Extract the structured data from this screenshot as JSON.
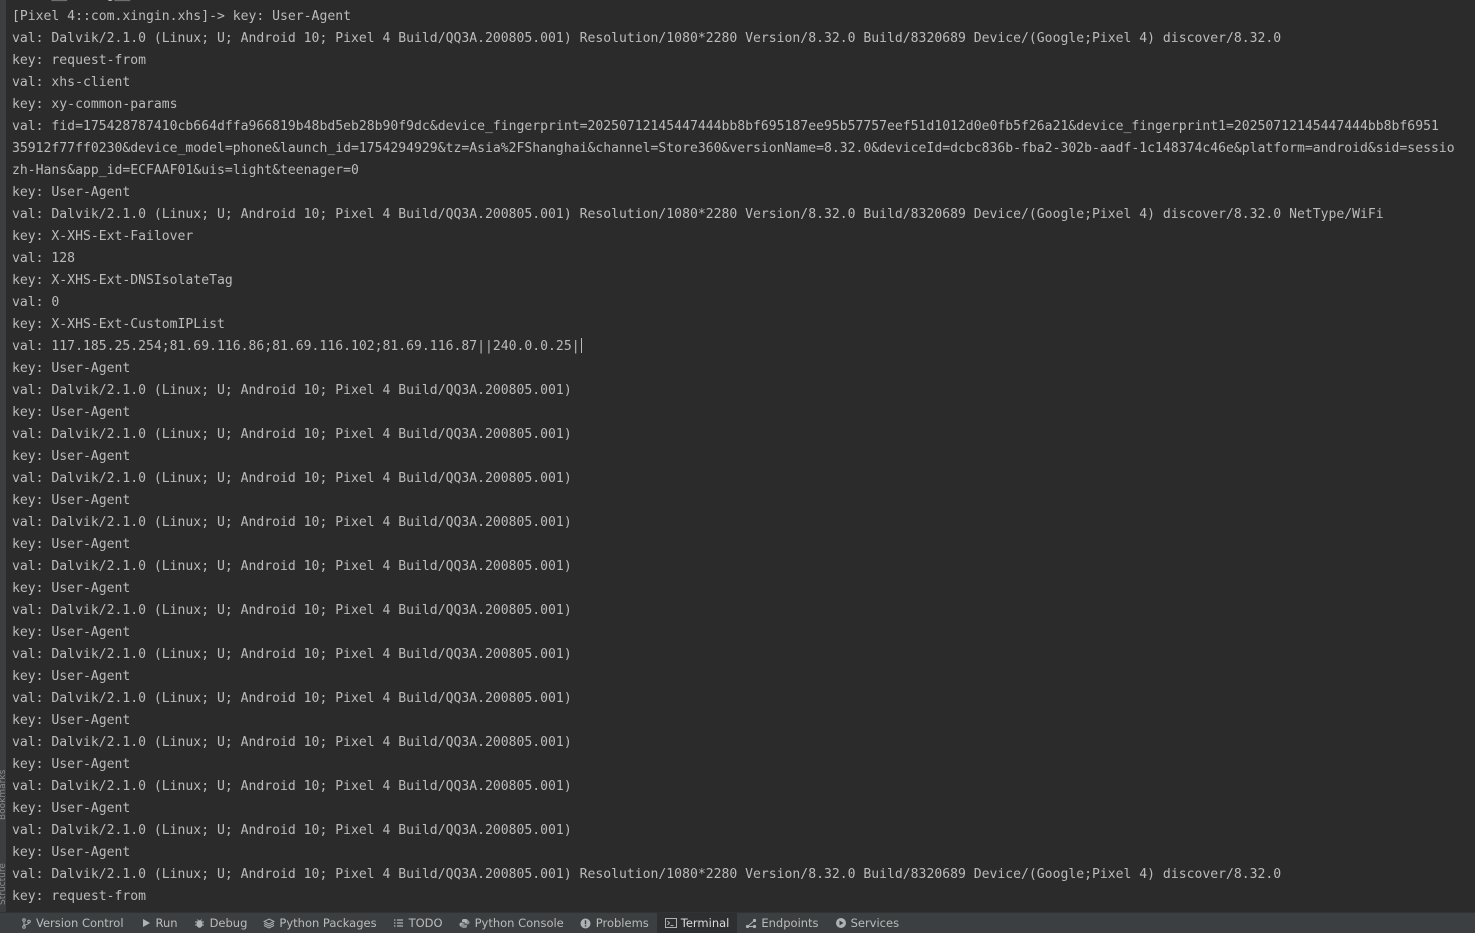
{
  "left_strip": {
    "bookmarks_label": "Bookmarks",
    "structure_label": "Structure"
  },
  "terminal": {
    "lines": [
      "val: __string__",
      "[Pixel 4::com.xingin.xhs]-> key: User-Agent",
      "val: Dalvik/2.1.0 (Linux; U; Android 10; Pixel 4 Build/QQ3A.200805.001) Resolution/1080*2280 Version/8.32.0 Build/8320689 Device/(Google;Pixel 4) discover/8.32.0",
      "key: request-from",
      "val: xhs-client",
      "key: xy-common-params",
      "val: fid=175428787410cb664dffa966819b48bd5eb28b90f9dc&device_fingerprint=20250712145447444bb8bf695187ee95b57757eef51d1012d0e0fb5f26a21&device_fingerprint1=20250712145447444bb8bf6951",
      "35912f77ff0230&device_model=phone&launch_id=1754294929&tz=Asia%2FShanghai&channel=Store360&versionName=8.32.0&deviceId=dcbc836b-fba2-302b-aadf-1c148374c46e&platform=android&sid=sessio",
      "zh-Hans&app_id=ECFAAF01&uis=light&teenager=0",
      "key: User-Agent",
      "val: Dalvik/2.1.0 (Linux; U; Android 10; Pixel 4 Build/QQ3A.200805.001) Resolution/1080*2280 Version/8.32.0 Build/8320689 Device/(Google;Pixel 4) discover/8.32.0 NetType/WiFi",
      "key: X-XHS-Ext-Failover",
      "val: 128",
      "key: X-XHS-Ext-DNSIsolateTag",
      "val: 0",
      "key: X-XHS-Ext-CustomIPList",
      "val: 117.185.25.254;81.69.116.86;81.69.116.102;81.69.116.87||240.0.0.25|",
      "key: User-Agent",
      "val: Dalvik/2.1.0 (Linux; U; Android 10; Pixel 4 Build/QQ3A.200805.001)",
      "key: User-Agent",
      "val: Dalvik/2.1.0 (Linux; U; Android 10; Pixel 4 Build/QQ3A.200805.001)",
      "key: User-Agent",
      "val: Dalvik/2.1.0 (Linux; U; Android 10; Pixel 4 Build/QQ3A.200805.001)",
      "key: User-Agent",
      "val: Dalvik/2.1.0 (Linux; U; Android 10; Pixel 4 Build/QQ3A.200805.001)",
      "key: User-Agent",
      "val: Dalvik/2.1.0 (Linux; U; Android 10; Pixel 4 Build/QQ3A.200805.001)",
      "key: User-Agent",
      "val: Dalvik/2.1.0 (Linux; U; Android 10; Pixel 4 Build/QQ3A.200805.001)",
      "key: User-Agent",
      "val: Dalvik/2.1.0 (Linux; U; Android 10; Pixel 4 Build/QQ3A.200805.001)",
      "key: User-Agent",
      "val: Dalvik/2.1.0 (Linux; U; Android 10; Pixel 4 Build/QQ3A.200805.001)",
      "key: User-Agent",
      "val: Dalvik/2.1.0 (Linux; U; Android 10; Pixel 4 Build/QQ3A.200805.001)",
      "key: User-Agent",
      "val: Dalvik/2.1.0 (Linux; U; Android 10; Pixel 4 Build/QQ3A.200805.001)",
      "key: User-Agent",
      "val: Dalvik/2.1.0 (Linux; U; Android 10; Pixel 4 Build/QQ3A.200805.001)",
      "key: User-Agent",
      "val: Dalvik/2.1.0 (Linux; U; Android 10; Pixel 4 Build/QQ3A.200805.001) Resolution/1080*2280 Version/8.32.0 Build/8320689 Device/(Google;Pixel 4) discover/8.32.0",
      "key: request-from"
    ],
    "cursor_line_index": 16
  },
  "bottom_bar": {
    "tabs": [
      {
        "label": "Version Control",
        "icon": "branch-icon",
        "active": false
      },
      {
        "label": "Run",
        "icon": "play-icon",
        "active": false
      },
      {
        "label": "Debug",
        "icon": "bug-icon",
        "active": false
      },
      {
        "label": "Python Packages",
        "icon": "layers-icon",
        "active": false
      },
      {
        "label": "TODO",
        "icon": "list-icon",
        "active": false
      },
      {
        "label": "Python Console",
        "icon": "python-icon",
        "active": false
      },
      {
        "label": "Problems",
        "icon": "info-icon",
        "active": false
      },
      {
        "label": "Terminal",
        "icon": "terminal-icon",
        "active": true
      },
      {
        "label": "Endpoints",
        "icon": "endpoints-icon",
        "active": false
      },
      {
        "label": "Services",
        "icon": "services-icon",
        "active": false
      }
    ]
  }
}
